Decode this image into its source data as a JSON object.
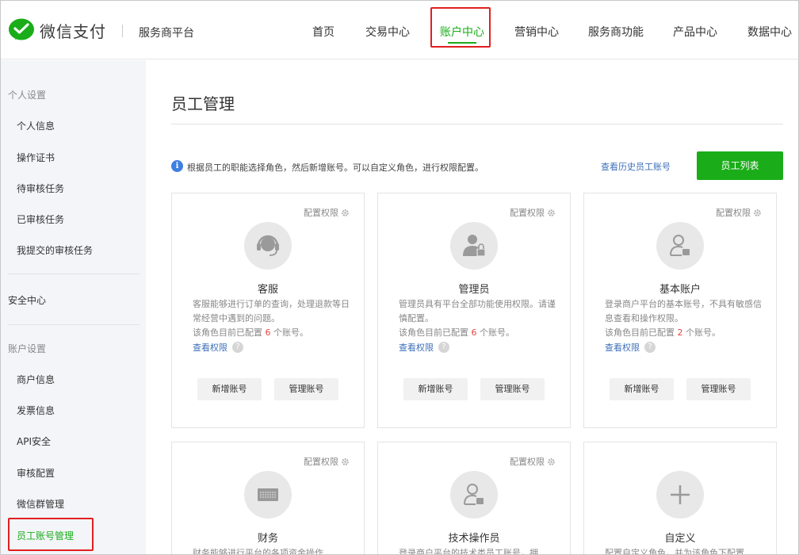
{
  "header": {
    "brand": "微信支付",
    "platform": "服务商平台",
    "nav": [
      "首页",
      "交易中心",
      "账户中心",
      "营销中心",
      "服务商功能",
      "产品中心",
      "数据中心"
    ],
    "active_nav": "账户中心"
  },
  "sidebar": {
    "section1_title": "个人设置",
    "section1_items": [
      "个人信息",
      "操作证书",
      "待审核任务",
      "已审核任务",
      "我提交的审核任务"
    ],
    "security": "安全中心",
    "section2_title": "账户设置",
    "section2_items": [
      "商户信息",
      "发票信息",
      "API安全",
      "审核配置",
      "微信群管理",
      "员工账号管理"
    ],
    "active_item": "员工账号管理"
  },
  "main": {
    "title": "员工管理",
    "info": "根据员工的职能选择角色，然后新增账号。可以自定义角色，进行权限配置。",
    "history_link": "查看历史员工账号",
    "list_button": "员工列表",
    "config_label": "配置权限",
    "cards": [
      {
        "name": "客服",
        "desc": "客服能够进行订单的查询，处理退款等日常经营中遇到的问题。",
        "count_prefix": "该角色目前已配置 ",
        "count": "6",
        "count_suffix": " 个账号。",
        "view": "查看权限",
        "add": "新增账号",
        "manage": "管理账号",
        "icon": "headset-icon"
      },
      {
        "name": "管理员",
        "desc": "管理员具有平台全部功能使用权限。请谨慎配置。",
        "count_prefix": "该角色目前已配置 ",
        "count": "6",
        "count_suffix": " 个账号。",
        "view": "查看权限",
        "add": "新增账号",
        "manage": "管理账号",
        "icon": "admin-lock-icon"
      },
      {
        "name": "基本账户",
        "desc": "登录商户平台的基本账号，不具有敏感信息查看和操作权限。",
        "count_prefix": "该角色目前已配置 ",
        "count": "2",
        "count_suffix": " 个账号。",
        "view": "查看权限",
        "add": "新增账号",
        "manage": "管理账号",
        "icon": "basic-user-icon"
      },
      {
        "name": "财务",
        "desc": "财务能够进行平台的各项资金操作",
        "icon": "finance-icon"
      },
      {
        "name": "技术操作员",
        "desc": "登录商户平台的技术类员工账号，拥",
        "icon": "tech-user-icon"
      },
      {
        "name": "自定义",
        "desc": "配置自定义角色，并为该角色下配置",
        "icon": "plus-icon"
      }
    ]
  }
}
